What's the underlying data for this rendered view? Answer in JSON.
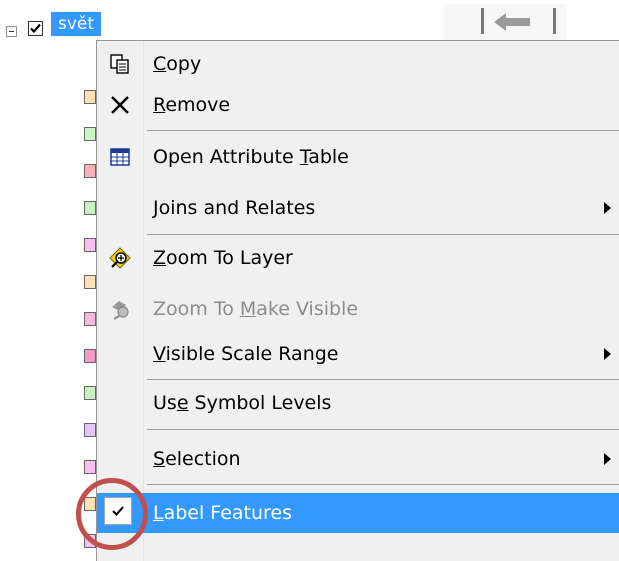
{
  "tree": {
    "layer_name": "svět",
    "checked": true,
    "expanded": true
  },
  "swatch_colors": [
    "#fde0b3",
    "#c8f5c0",
    "#f8b3b8",
    "#c9f1c3",
    "#f7c0f0",
    "#fde0b3",
    "#f7b6dc",
    "#f59bc8",
    "#c9f1c3",
    "#e6c3f5",
    "#f7c0f0",
    "#fde0b3",
    "#f7c0f0"
  ],
  "menu": {
    "items": [
      {
        "pre": "",
        "key": "C",
        "post": "opy",
        "icon": "copy-icon",
        "enabled": true
      },
      {
        "pre": "",
        "key": "R",
        "post": "emove",
        "icon": "remove-icon",
        "enabled": true
      },
      {
        "pre": "Open Attribute ",
        "key": "T",
        "post": "able",
        "icon": "attribute-table-icon",
        "enabled": true
      },
      {
        "pre": "",
        "key": "J",
        "post": "oins and Relates",
        "icon": "",
        "enabled": true,
        "submenu": true
      },
      {
        "pre": "",
        "key": "Z",
        "post": "oom To Layer",
        "icon": "zoom-to-layer-icon",
        "enabled": true
      },
      {
        "pre": "Zoom To ",
        "key": "M",
        "post": "ake Visible",
        "icon": "zoom-to-make-visible-icon",
        "enabled": false
      },
      {
        "pre": "",
        "key": "V",
        "post": "isible Scale Range",
        "icon": "",
        "enabled": true,
        "submenu": true
      },
      {
        "pre": "Us",
        "key": "e",
        "post": " Symbol Levels",
        "icon": "",
        "enabled": true
      },
      {
        "pre": "",
        "key": "S",
        "post": "election",
        "icon": "",
        "enabled": true,
        "submenu": true
      },
      {
        "pre": "",
        "key": "L",
        "post": "abel Features",
        "icon": "",
        "enabled": true,
        "checked": true,
        "highlighted": true
      }
    ]
  },
  "colors": {
    "highlight": "#3399ff",
    "annotation_ring": "#c0504d"
  }
}
